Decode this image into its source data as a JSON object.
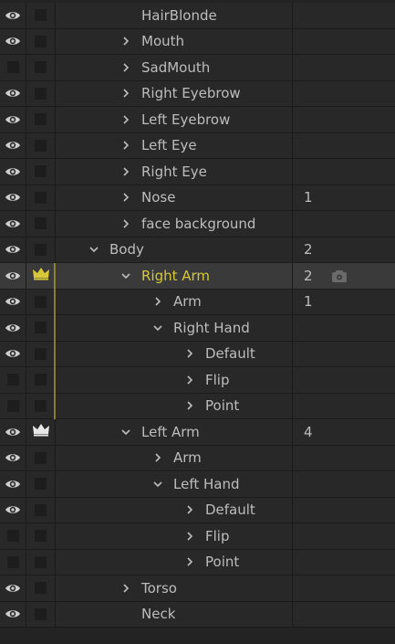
{
  "rows": [
    {
      "label": "HairBlonde",
      "depth": 2,
      "caret": "",
      "visible": true,
      "count": "",
      "crown": "",
      "selected": false
    },
    {
      "label": "Mouth",
      "depth": 2,
      "caret": "right",
      "visible": true,
      "count": "",
      "crown": "",
      "selected": false
    },
    {
      "label": "SadMouth",
      "depth": 2,
      "caret": "right",
      "visible": false,
      "count": "",
      "crown": "",
      "selected": false
    },
    {
      "label": "Right Eyebrow",
      "depth": 2,
      "caret": "right",
      "visible": true,
      "count": "",
      "crown": "",
      "selected": false
    },
    {
      "label": "Left Eyebrow",
      "depth": 2,
      "caret": "right",
      "visible": true,
      "count": "",
      "crown": "",
      "selected": false
    },
    {
      "label": "Left Eye",
      "depth": 2,
      "caret": "right",
      "visible": true,
      "count": "",
      "crown": "",
      "selected": false
    },
    {
      "label": "Right Eye",
      "depth": 2,
      "caret": "right",
      "visible": true,
      "count": "",
      "crown": "",
      "selected": false
    },
    {
      "label": "Nose",
      "depth": 2,
      "caret": "right",
      "visible": true,
      "count": "1",
      "crown": "",
      "selected": false
    },
    {
      "label": "face background",
      "depth": 2,
      "caret": "right",
      "visible": true,
      "count": "",
      "crown": "",
      "selected": false
    },
    {
      "label": "Body",
      "depth": 1,
      "caret": "down",
      "visible": true,
      "count": "2",
      "crown": "",
      "selected": false
    },
    {
      "label": "Right Arm",
      "depth": 2,
      "caret": "down",
      "visible": true,
      "count": "2",
      "crown": "yellow",
      "selected": true
    },
    {
      "label": "Arm",
      "depth": 3,
      "caret": "right",
      "visible": true,
      "count": "1",
      "crown": "",
      "selected": false
    },
    {
      "label": "Right Hand",
      "depth": 3,
      "caret": "down",
      "visible": true,
      "count": "",
      "crown": "",
      "selected": false
    },
    {
      "label": "Default",
      "depth": 4,
      "caret": "right",
      "visible": true,
      "count": "",
      "crown": "",
      "selected": false
    },
    {
      "label": "Flip",
      "depth": 4,
      "caret": "right",
      "visible": false,
      "count": "",
      "crown": "",
      "selected": false
    },
    {
      "label": "Point",
      "depth": 4,
      "caret": "right",
      "visible": false,
      "count": "",
      "crown": "",
      "selected": false
    },
    {
      "label": "Left Arm",
      "depth": 2,
      "caret": "down",
      "visible": true,
      "count": "4",
      "crown": "white",
      "selected": false
    },
    {
      "label": "Arm",
      "depth": 3,
      "caret": "right",
      "visible": true,
      "count": "",
      "crown": "",
      "selected": false
    },
    {
      "label": "Left Hand",
      "depth": 3,
      "caret": "down",
      "visible": true,
      "count": "",
      "crown": "",
      "selected": false
    },
    {
      "label": "Default",
      "depth": 4,
      "caret": "right",
      "visible": true,
      "count": "",
      "crown": "",
      "selected": false
    },
    {
      "label": "Flip",
      "depth": 4,
      "caret": "right",
      "visible": false,
      "count": "",
      "crown": "",
      "selected": false
    },
    {
      "label": "Point",
      "depth": 4,
      "caret": "right",
      "visible": false,
      "count": "",
      "crown": "",
      "selected": false
    },
    {
      "label": "Torso",
      "depth": 2,
      "caret": "right",
      "visible": true,
      "count": "",
      "crown": "",
      "selected": false
    },
    {
      "label": "Neck",
      "depth": 2,
      "caret": "",
      "visible": true,
      "count": "",
      "crown": "",
      "selected": false
    }
  ],
  "icons": {
    "visibility": "eye-icon",
    "expand": "chevron-right-icon",
    "collapse": "chevron-down-icon",
    "origin": "crown-icon",
    "rig": "rig-icon"
  },
  "colors": {
    "selected_text": "#d6c83a",
    "crown_yellow": "#d6c83a",
    "crown_white": "#e6e6e6"
  }
}
